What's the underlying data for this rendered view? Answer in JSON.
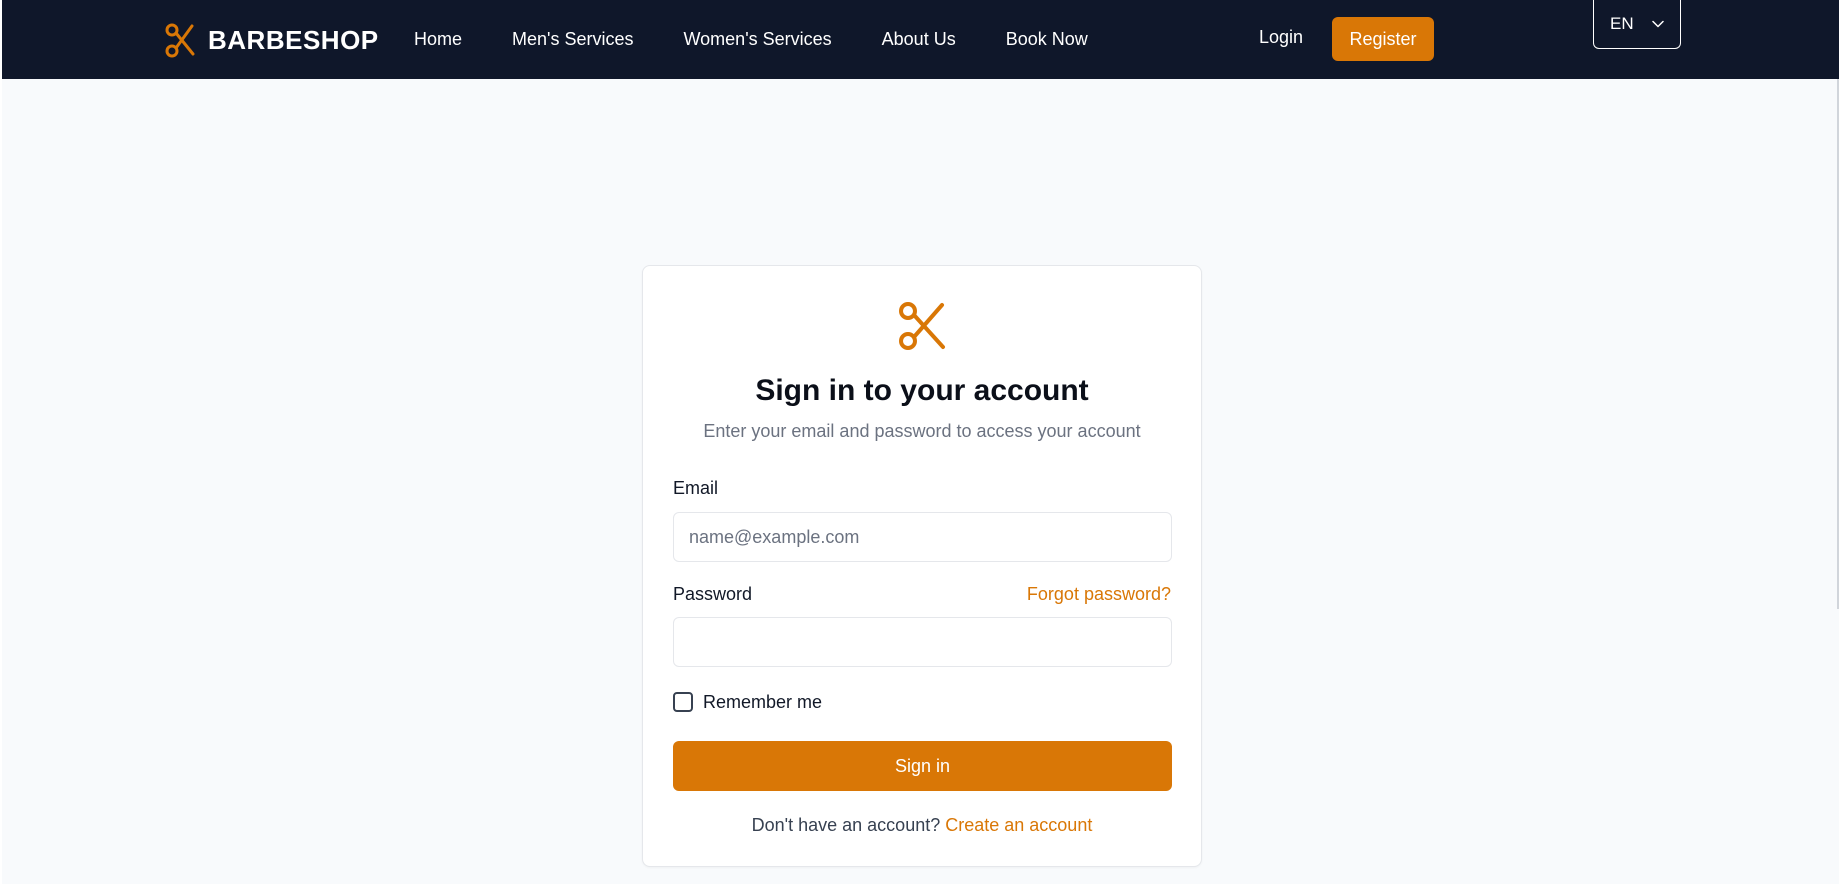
{
  "navbar": {
    "brand_name": "BARBESHOP",
    "brand_icon": "scissors-icon",
    "links": [
      {
        "label": "Home"
      },
      {
        "label": "Men's Services"
      },
      {
        "label": "Women's Services"
      },
      {
        "label": "About Us"
      },
      {
        "label": "Book Now"
      }
    ],
    "login_label": "Login",
    "register_label": "Register",
    "language": "EN",
    "language_icon": "chevron-down-icon"
  },
  "login_card": {
    "icon": "scissors-icon",
    "title": "Sign in to your account",
    "subtitle": "Enter your email and password to access your account",
    "email_label": "Email",
    "email_placeholder": "name@example.com",
    "email_value": "",
    "password_label": "Password",
    "password_value": "",
    "forgot_label": "Forgot password?",
    "remember_label": "Remember me",
    "remember_checked": false,
    "submit_label": "Sign in",
    "signup_prompt": "Don't have an account?",
    "signup_link": "Create an account"
  },
  "colors": {
    "navbar_bg": "#0f172a",
    "accent": "#d97706",
    "page_bg": "#f8fafc"
  }
}
